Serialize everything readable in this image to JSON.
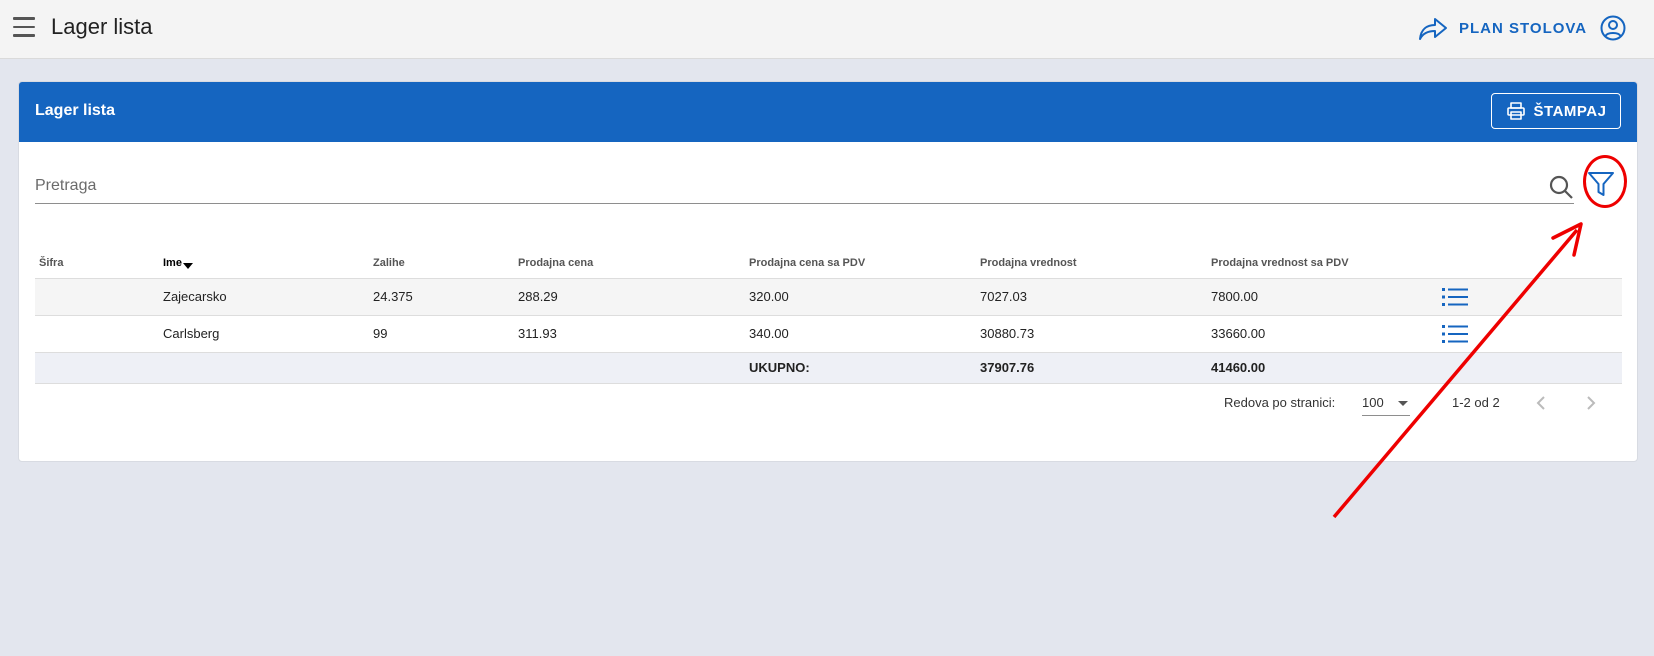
{
  "app": {
    "title": "Lager lista"
  },
  "topbar": {
    "plan_label": "PLAN STOLOVA"
  },
  "card": {
    "title": "Lager lista",
    "print_label": "ŠTAMPAJ"
  },
  "search": {
    "placeholder": "Pretraga",
    "value": ""
  },
  "table": {
    "columns": [
      "Šifra",
      "Ime",
      "Zalihe",
      "Prodajna cena",
      "Prodajna cena sa PDV",
      "Prodajna vrednost",
      "Prodajna vrednost sa PDV"
    ],
    "rows": [
      {
        "sifra": "",
        "ime": "Zajecarsko",
        "zalihe": "24.375",
        "cena": "288.29",
        "cena_pdv": "320.00",
        "vrednost": "7027.03",
        "vrednost_pdv": "7800.00"
      },
      {
        "sifra": "",
        "ime": "Carlsberg",
        "zalihe": "99",
        "cena": "311.93",
        "cena_pdv": "340.00",
        "vrednost": "30880.73",
        "vrednost_pdv": "33660.00"
      }
    ],
    "total": {
      "label": "UKUPNO:",
      "vrednost": "37907.76",
      "vrednost_pdv": "41460.00"
    }
  },
  "pagination": {
    "rows_label": "Redova po stranici:",
    "rows_value": "100",
    "range": "1-2 od 2"
  },
  "colors": {
    "primary": "#1565c0",
    "annotation": "#e00000",
    "background": "#e3e6ee"
  },
  "icons": [
    "menu-icon",
    "share-arrow-icon",
    "account-icon",
    "printer-icon",
    "search-icon",
    "filter-icon",
    "list-icon",
    "chevron-left-icon",
    "chevron-right-icon"
  ]
}
